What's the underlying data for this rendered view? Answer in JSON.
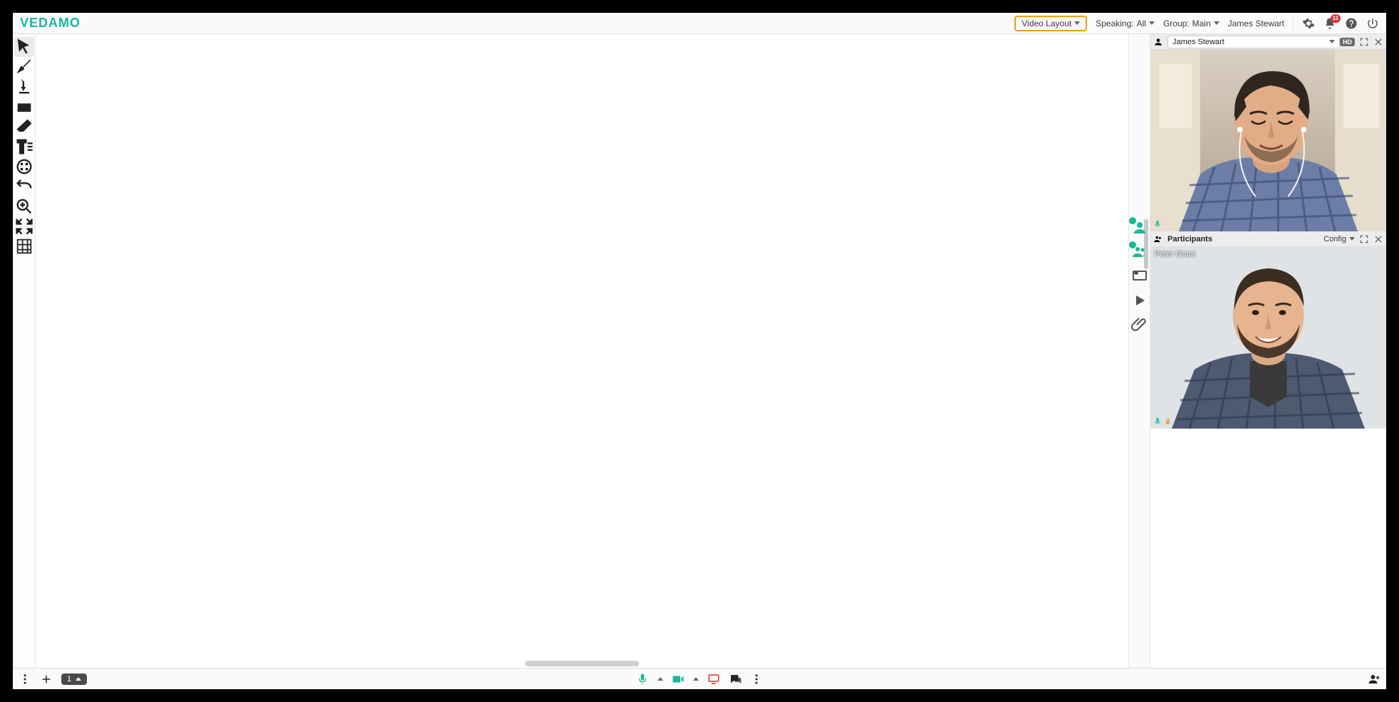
{
  "app": {
    "logo": "VEDAMO"
  },
  "header": {
    "video_layout": "Video Layout",
    "speaking_label": "Speaking:",
    "speaking_value": "All",
    "group_label": "Group:",
    "group_value": "Main",
    "user_name": "James Stewart",
    "notification_count": "11"
  },
  "right": {
    "self_name": "James Stewart",
    "hd": "HD",
    "participants_title": "Participants",
    "config_label": "Config",
    "participant_name": "Peter Grant"
  },
  "bottom": {
    "page_number": "1"
  }
}
